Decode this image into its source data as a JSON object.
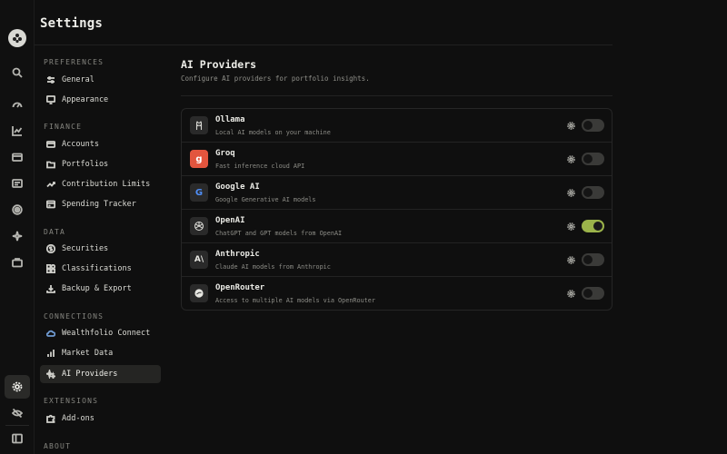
{
  "page": {
    "title": "Settings"
  },
  "colors": {
    "accent": "#9bb34a",
    "background": "#0f0f0f",
    "active_nav": "#252523"
  },
  "rail": {
    "icons": [
      "logo-icon",
      "search-icon",
      "dashboard-icon",
      "chart-icon",
      "wallet-icon",
      "list-icon",
      "target-icon",
      "sparkle-icon",
      "briefcase-icon",
      "settings-icon",
      "eye-off-icon",
      "sidebar-icon"
    ],
    "active": "settings-icon"
  },
  "nav": {
    "groups": [
      {
        "label": "PREFERENCES",
        "items": [
          {
            "label": "General",
            "icon": "sliders-icon"
          },
          {
            "label": "Appearance",
            "icon": "monitor-icon"
          }
        ]
      },
      {
        "label": "FINANCE",
        "items": [
          {
            "label": "Accounts",
            "icon": "card-icon"
          },
          {
            "label": "Portfolios",
            "icon": "folder-icon"
          },
          {
            "label": "Contribution Limits",
            "icon": "trend-icon"
          },
          {
            "label": "Spending Tracker",
            "icon": "receipt-icon"
          }
        ]
      },
      {
        "label": "DATA",
        "items": [
          {
            "label": "Securities",
            "icon": "dollar-icon"
          },
          {
            "label": "Classifications",
            "icon": "shapes-icon"
          },
          {
            "label": "Backup & Export",
            "icon": "download-icon"
          }
        ]
      },
      {
        "label": "CONNECTIONS",
        "items": [
          {
            "label": "Wealthfolio Connect",
            "icon": "cloud-icon"
          },
          {
            "label": "Market Data",
            "icon": "bars-icon"
          },
          {
            "label": "AI Providers",
            "icon": "sparkle-icon"
          }
        ]
      },
      {
        "label": "EXTENSIONS",
        "items": [
          {
            "label": "Add-ons",
            "icon": "puzzle-icon"
          }
        ]
      },
      {
        "label": "ABOUT",
        "items": []
      }
    ],
    "active_item": "AI Providers"
  },
  "main": {
    "title": "AI Providers",
    "subtitle": "Configure AI providers for portfolio insights.",
    "providers": [
      {
        "name": "Ollama",
        "description": "Local AI models on your machine",
        "logo": "ollama-icon",
        "enabled": false
      },
      {
        "name": "Groq",
        "description": "Fast inference cloud API",
        "logo": "groq-icon",
        "logo_text": "g",
        "logo_color": "#e2553e",
        "enabled": false
      },
      {
        "name": "Google AI",
        "description": "Google Generative AI models",
        "logo": "google-icon",
        "logo_text": "G",
        "enabled": false
      },
      {
        "name": "OpenAI",
        "description": "ChatGPT and GPT models from OpenAI",
        "logo": "openai-icon",
        "enabled": true
      },
      {
        "name": "Anthropic",
        "description": "Claude AI models from Anthropic",
        "logo": "anthropic-icon",
        "logo_text": "A\\",
        "enabled": false
      },
      {
        "name": "OpenRouter",
        "description": "Access to multiple AI models via OpenRouter",
        "logo": "openrouter-icon",
        "enabled": false
      }
    ]
  }
}
